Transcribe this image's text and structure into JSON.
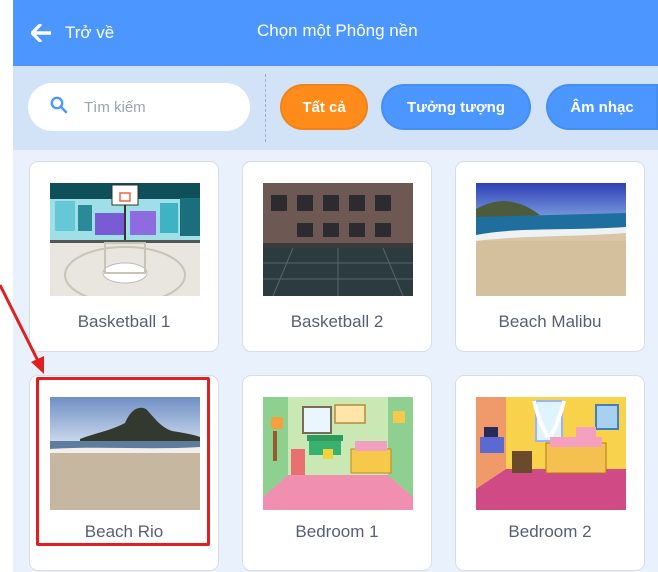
{
  "header": {
    "back_label": "Trở về",
    "title": "Chọn một Phông nền",
    "back_icon": "arrow-left-icon"
  },
  "search": {
    "placeholder": "Tìm kiếm",
    "value": "",
    "icon": "search-icon"
  },
  "filters": [
    {
      "label": "Tất cả",
      "active": true
    },
    {
      "label": "Tưởng tượng",
      "active": false
    },
    {
      "label": "Âm nhạc",
      "active": false
    }
  ],
  "backdrops": [
    {
      "name": "Basketball 1",
      "highlighted": false
    },
    {
      "name": "Basketball 2",
      "highlighted": false
    },
    {
      "name": "Beach Malibu",
      "highlighted": false
    },
    {
      "name": "Beach Rio",
      "highlighted": true
    },
    {
      "name": "Bedroom 1",
      "highlighted": false
    },
    {
      "name": "Bedroom 2",
      "highlighted": false
    }
  ],
  "colors": {
    "header": "#4c97ff",
    "filter_bar": "#d2e2f7",
    "active_filter": "#ff8c1a",
    "highlight": "#e02020"
  }
}
